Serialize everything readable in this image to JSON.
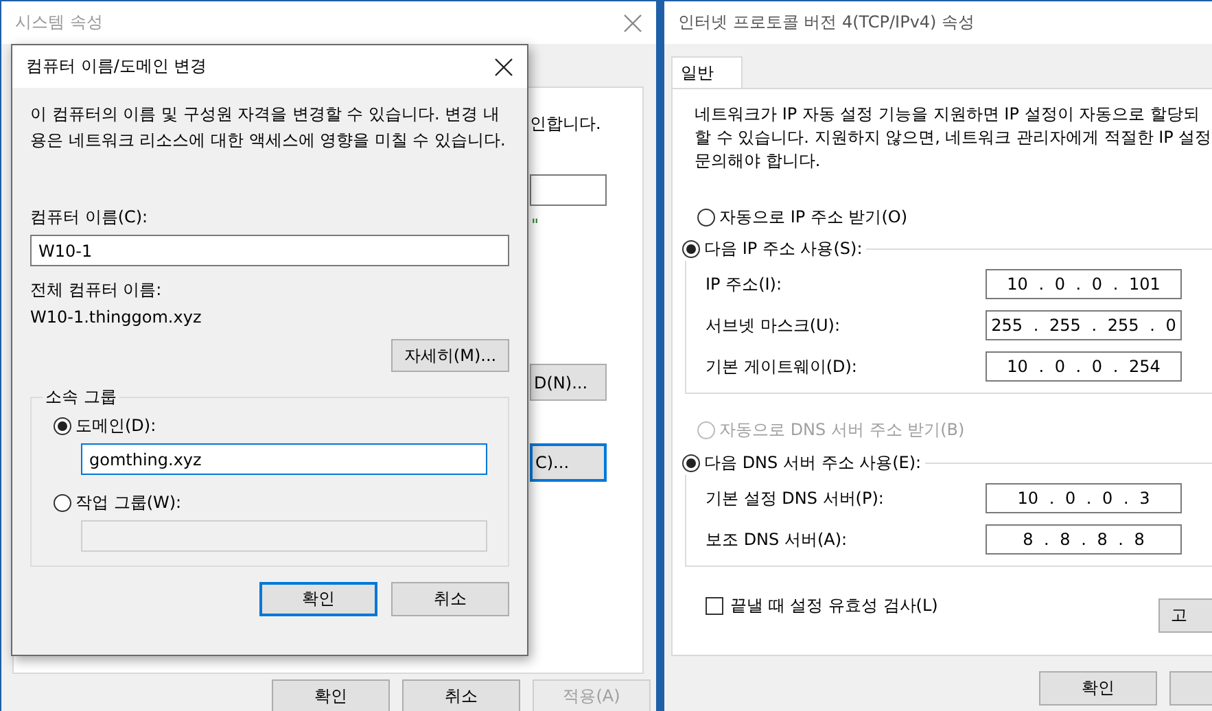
{
  "system_properties": {
    "title": "시스템 속성",
    "active": false,
    "hidden_text": "인합니다.",
    "hidden_quote": "\"",
    "hidden_buttons": [
      {
        "label": "D(N)...",
        "focused": false
      },
      {
        "label": "C)...",
        "focused": true
      }
    ],
    "buttons": [
      {
        "label": "확인",
        "disabled": false
      },
      {
        "label": "취소",
        "disabled": false
      },
      {
        "label": "적용(A)",
        "disabled": true
      }
    ]
  },
  "name_dialog": {
    "title": "컴퓨터 이름/도메인 변경",
    "description": "이 컴퓨터의 이름 및 구성원 자격을 변경할 수 있습니다. 변경 내용은 네트워크 리소스에 대한 액세스에 영향을 미칠 수 있습니다.",
    "computer_name_label": "컴퓨터 이름(C):",
    "computer_name": "W10-1",
    "full_name_label": "전체 컴퓨터 이름:",
    "full_name": "W10-1.thinggom.xyz",
    "more_button": "자세히(M)...",
    "member_of": {
      "label": "소속 그룹",
      "options": [
        {
          "label": "도메인(D):",
          "selected": true,
          "value": "gomthing.xyz"
        },
        {
          "label": "작업 그룹(W):",
          "selected": false
        }
      ]
    },
    "buttons": [
      {
        "label": "확인",
        "default": true
      },
      {
        "label": "취소",
        "default": false
      }
    ]
  },
  "ipv4_properties": {
    "title": "인터넷 프로토콜 버전 4(TCP/IPv4) 속성",
    "active": true,
    "tabs": [
      {
        "label": "일반",
        "selected": true
      }
    ],
    "description_lines": [
      "네트워크가 IP 자동 설정 기능을 지원하면 IP 설정이 자동으로 할당되",
      "할 수 있습니다. 지원하지 않으면, 네트워크 관리자에게 적절한 IP 설정",
      "문의해야 합니다."
    ],
    "ip_options": [
      {
        "label": "자동으로 IP 주소 받기(O)",
        "selected": false,
        "disabled": false
      },
      {
        "label": "다음 IP 주소 사용(S):",
        "selected": true,
        "disabled": false
      }
    ],
    "ip_fields": [
      {
        "label": "IP 주소(I):",
        "value": "10 . 0 . 0 . 101"
      },
      {
        "label": "서브넷 마스크(U):",
        "value": "255 . 255 . 255 . 0"
      },
      {
        "label": "기본 게이트웨이(D):",
        "value": "10 . 0 . 0 . 254"
      }
    ],
    "dns_options": [
      {
        "label": "자동으로 DNS 서버 주소 받기(B)",
        "selected": false,
        "disabled": true
      },
      {
        "label": "다음 DNS 서버 주소 사용(E):",
        "selected": true,
        "disabled": false
      }
    ],
    "dns_fields": [
      {
        "label": "기본 설정 DNS 서버(P):",
        "value": "10 . 0 . 0 . 3"
      },
      {
        "label": "보조 DNS 서버(A):",
        "value": "8 . 8 . 8 . 8"
      }
    ],
    "validate": {
      "label": "끝낼 때 설정 유효성 검사(L)",
      "checked": false
    },
    "advanced_button": "고",
    "buttons": [
      "확인"
    ]
  }
}
